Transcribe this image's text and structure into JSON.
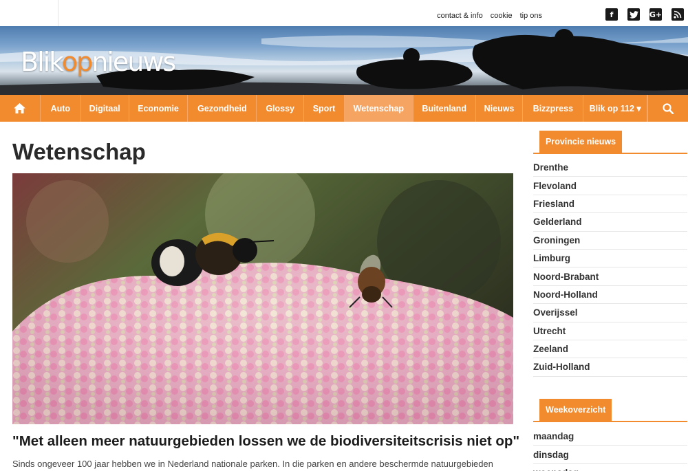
{
  "topbar": {
    "links": [
      "contact & info",
      "cookie",
      "tip ons"
    ],
    "social": [
      {
        "icon": "facebook-icon",
        "glyph": "f"
      },
      {
        "icon": "twitter-icon",
        "glyph": "t"
      },
      {
        "icon": "google-plus-icon",
        "glyph": "G+"
      },
      {
        "icon": "rss-icon",
        "glyph": ")"
      }
    ]
  },
  "logo": {
    "part1": "Blik",
    "part2": "op",
    "part3": "nieuws",
    "accent": "#f28a2e"
  },
  "nav": {
    "home_icon": "home-icon",
    "items": [
      "Auto",
      "Digitaal",
      "Economie",
      "Gezondheid",
      "Glossy",
      "Sport",
      "Wetenschap",
      "Buitenland",
      "Nieuws",
      "Bizzpress",
      "Blik op 112 ▾"
    ],
    "active": "Wetenschap",
    "search_icon": "search-icon"
  },
  "page": {
    "title": "Wetenschap"
  },
  "article": {
    "headline": "\"Met alleen meer natuurgebieden lossen we de biodiversiteitscrisis niet op\"",
    "excerpt": "Sinds ongeveer 100 jaar hebben we in Nederland nationale parken. In die parken en andere beschermde natuurgebieden"
  },
  "sidebar": {
    "provinces_title": "Provincie nieuws",
    "provinces": [
      "Drenthe",
      "Flevoland",
      "Friesland",
      "Gelderland",
      "Groningen",
      "Limburg",
      "Noord-Brabant",
      "Noord-Holland",
      "Overijssel",
      "Utrecht",
      "Zeeland",
      "Zuid-Holland"
    ],
    "week_title": "Weekoverzicht",
    "days": [
      "maandag",
      "dinsdag",
      "woensdag"
    ]
  }
}
